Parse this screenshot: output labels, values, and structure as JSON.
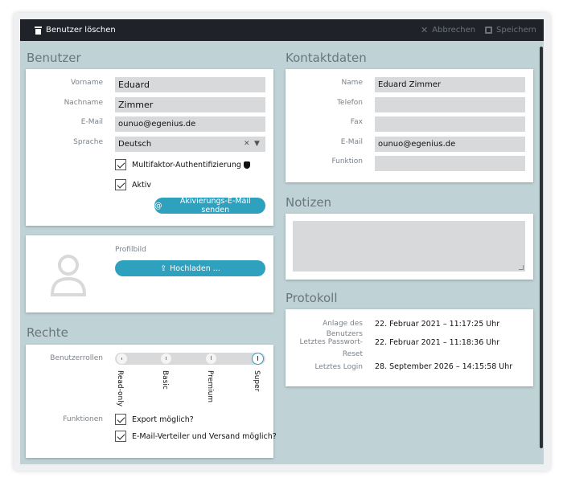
{
  "toolbar": {
    "delete_label": "Benutzer löschen",
    "cancel_label": "Abbrechen",
    "save_label": "Speichern"
  },
  "benutzer": {
    "title": "Benutzer",
    "vorname_label": "Vorname",
    "vorname": "Eduard",
    "nachname_label": "Nachname",
    "nachname": "Zimmer",
    "email_label": "E-Mail",
    "email": "ounuo@egenius.de",
    "sprache_label": "Sprache",
    "sprache": "Deutsch",
    "mfa_label": "Multifaktor-Authentifizierung",
    "aktiv_label": "Aktiv",
    "activation_button": "Akivierungs-E-Mail senden"
  },
  "profilbild": {
    "label": "Profilbild",
    "upload_button": "Hochladen ..."
  },
  "rechte": {
    "title": "Rechte",
    "rollen_label": "Benutzerrollen",
    "roles": [
      "Read-only",
      "Basic",
      "Premium",
      "Super"
    ],
    "selected_role": "Super",
    "funktionen_label": "Funktionen",
    "export_label": "Export möglich?",
    "verteiler_label": "E-Mail-Verteiler und Versand möglich?"
  },
  "kontakt": {
    "title": "Kontaktdaten",
    "name_label": "Name",
    "name": "Eduard Zimmer",
    "telefon_label": "Telefon",
    "telefon": "",
    "fax_label": "Fax",
    "fax": "",
    "email_label": "E-Mail",
    "email": "ounuo@egenius.de",
    "funktion_label": "Funktion",
    "funktion": ""
  },
  "notizen": {
    "title": "Notizen"
  },
  "protokoll": {
    "title": "Protokoll",
    "anlage_label": "Anlage des Benutzers",
    "anlage_value": "22. Februar 2021 – 11:17:25 Uhr",
    "reset_label_1": "Letztes Passwort-",
    "reset_label_2": "Reset",
    "reset_value": "22. Februar 2021 – 11:18:36 Uhr",
    "login_label": "Letztes Login",
    "login_value": "28. September 2026 – 14:15:58 Uhr"
  },
  "colors": {
    "accent": "#2ea1bf",
    "toolbar_bg": "#1f2329",
    "workspace_bg": "#bfd2d6"
  },
  "icons": [
    "trash-icon",
    "close-icon",
    "save-icon",
    "shield-icon",
    "at-icon",
    "upload-icon",
    "avatar-icon",
    "clear-icon",
    "chevron-down-icon"
  ]
}
